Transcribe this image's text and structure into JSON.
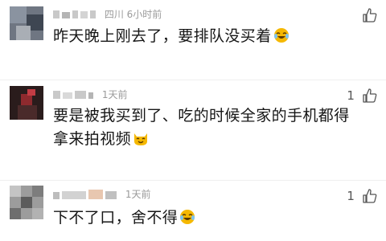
{
  "comments": [
    {
      "meta": "四川 6小时前",
      "text": "昨天晚上刚去了，要排队没买着",
      "emoji_icon": "laughing-tears-emoji",
      "like_count": ""
    },
    {
      "meta": "1天前",
      "text": "要是被我买到了、吃的时候全家的手机都得拿来拍视频",
      "emoji_icon": "cat-smile-emoji",
      "like_count": "1"
    },
    {
      "meta": "1天前",
      "text": "下不了口，舍不得",
      "emoji_icon": "laughing-tears-emoji",
      "like_count": "1"
    }
  ],
  "icons": {
    "like": "thumbs-up-icon"
  },
  "colors": {
    "text": "#161616",
    "meta": "#9a9a9a",
    "emoji": "#f5b800"
  }
}
